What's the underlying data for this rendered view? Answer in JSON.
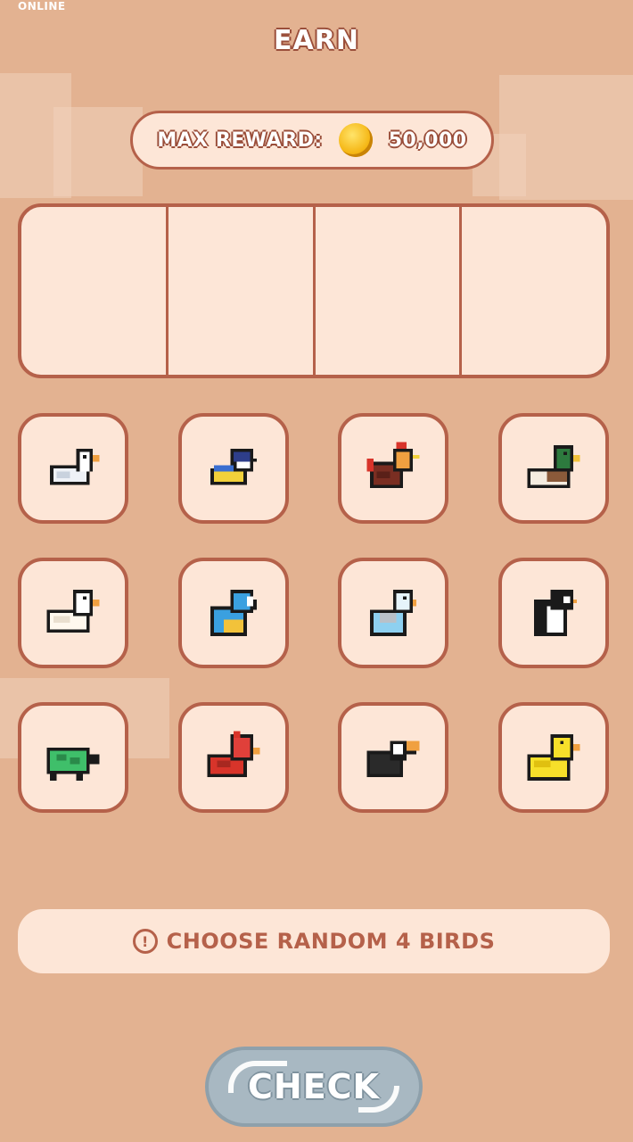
{
  "status": {
    "network": "ONLINE"
  },
  "header": {
    "title": "EARN"
  },
  "reward": {
    "label": "MAX REWARD:",
    "amount": "50,000",
    "icon": "gold-coin-icon"
  },
  "slots": {
    "count": 4,
    "filled": 0
  },
  "birds": [
    {
      "name": "white-goose",
      "icon": "goose-icon"
    },
    {
      "name": "blue-tit",
      "icon": "blue-tit-icon"
    },
    {
      "name": "rooster",
      "icon": "rooster-icon"
    },
    {
      "name": "mallard",
      "icon": "mallard-icon"
    },
    {
      "name": "white-duck",
      "icon": "white-duck-icon"
    },
    {
      "name": "blue-parrot",
      "icon": "parrot-icon"
    },
    {
      "name": "budgie",
      "icon": "budgie-icon"
    },
    {
      "name": "penguin",
      "icon": "penguin-icon"
    },
    {
      "name": "turtle",
      "icon": "turtle-icon"
    },
    {
      "name": "cardinal",
      "icon": "cardinal-icon"
    },
    {
      "name": "toucan",
      "icon": "toucan-icon"
    },
    {
      "name": "rubber-duck",
      "icon": "rubber-duck-icon"
    }
  ],
  "hint": {
    "text": "CHOOSE RANDOM 4 BIRDS",
    "icon": "exclamation-circle-icon"
  },
  "actions": {
    "check_label": "CHECK"
  },
  "colors": {
    "background": "#e3b291",
    "card": "#fde6d7",
    "border": "#b5614a",
    "button": "#a8b8c2"
  }
}
